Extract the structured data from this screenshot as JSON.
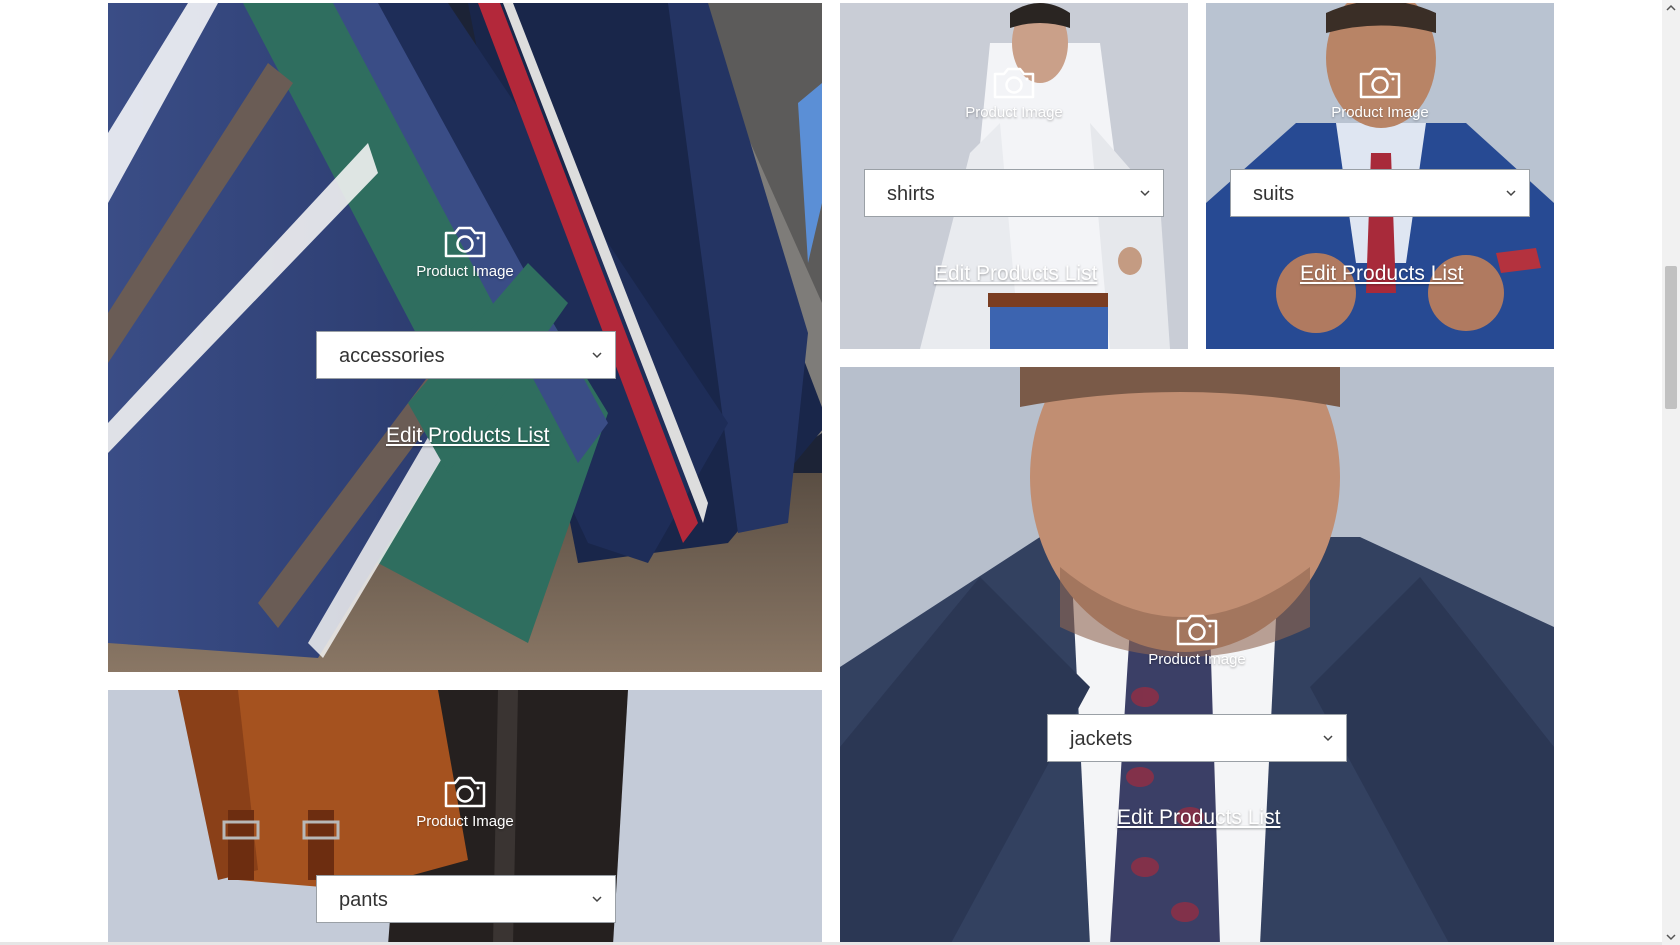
{
  "tiles": {
    "accessories": {
      "image_label": "Product Image",
      "category": "accessories",
      "edit_label": "Edit Products List"
    },
    "shirts": {
      "image_label": "Product Image",
      "category": "shirts",
      "edit_label": "Edit Products List"
    },
    "suits": {
      "image_label": "Product Image",
      "category": "suits",
      "edit_label": "Edit Products List"
    },
    "jackets": {
      "image_label": "Product Image",
      "category": "jackets",
      "edit_label": "Edit Products List"
    },
    "pants": {
      "image_label": "Product Image",
      "category": "pants"
    }
  },
  "icons": {
    "image": "camera-icon",
    "dropdown": "chevron-down-icon"
  },
  "colors": {
    "link_text": "#ffffff",
    "select_border": "#9aa0a6",
    "page_bg": "#ffffff"
  }
}
